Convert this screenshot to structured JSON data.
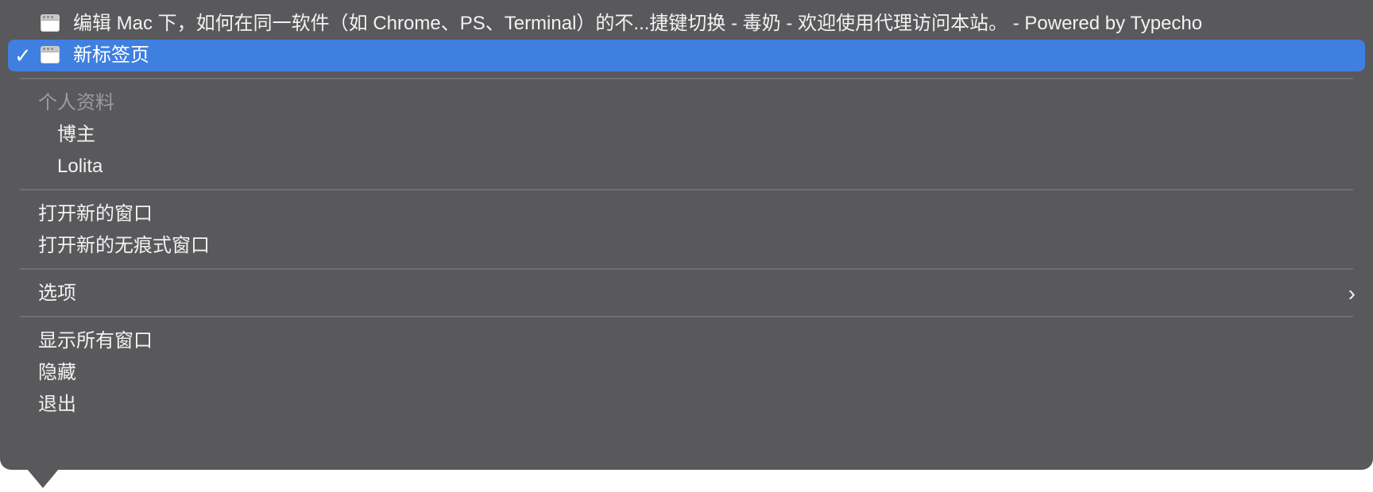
{
  "windows": [
    {
      "title": "编辑 Mac 下，如何在同一软件（如 Chrome、PS、Terminal）的不...捷键切换 - 毒奶 - 欢迎使用代理访问本站。 - Powered by Typecho",
      "icon": "browser-window-icon",
      "selected": false
    },
    {
      "title": "新标签页",
      "icon": "browser-window-icon",
      "selected": true
    }
  ],
  "checkmark": "✓",
  "profiles": {
    "header": "个人资料",
    "items": [
      "博主",
      "Lolita"
    ]
  },
  "actions": {
    "new_window": "打开新的窗口",
    "new_incognito_window": "打开新的无痕式窗口",
    "options": "选项",
    "options_chevron": "›",
    "show_all_windows": "显示所有窗口",
    "hide": "隐藏",
    "quit": "退出"
  },
  "colors": {
    "menu_background": "#59595c",
    "selection": "#3f7fe0",
    "text": "#f2f2f2",
    "header_text": "#9c9ca0"
  }
}
